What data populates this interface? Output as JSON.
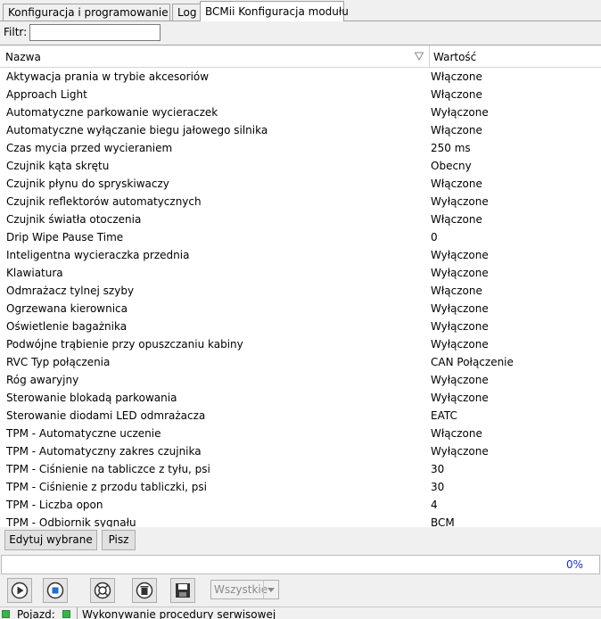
{
  "tabs": [
    {
      "label": "Konfiguracja i programowanie"
    },
    {
      "label": "Log"
    },
    {
      "label": "BCMii Konfiguracja modułu"
    }
  ],
  "filter": {
    "label": "Filtr:",
    "value": ""
  },
  "table": {
    "columns": {
      "name": "Nazwa",
      "value": "Wartość"
    },
    "rows": [
      {
        "name": "Aktywacja prania w trybie akcesoriów",
        "value": "Włączone"
      },
      {
        "name": "Approach Light",
        "value": "Włączone"
      },
      {
        "name": "Automatyczne parkowanie wycieraczek",
        "value": "Wyłączone"
      },
      {
        "name": "Automatyczne wyłączanie biegu jałowego silnika",
        "value": "Włączone"
      },
      {
        "name": "Czas mycia przed wycieraniem",
        "value": "250 ms"
      },
      {
        "name": "Czujnik kąta skrętu",
        "value": "Obecny"
      },
      {
        "name": "Czujnik płynu do spryskiwaczy",
        "value": "Włączone"
      },
      {
        "name": "Czujnik reflektorów automatycznych",
        "value": "Wyłączone"
      },
      {
        "name": "Czujnik światła otoczenia",
        "value": "Włączone"
      },
      {
        "name": "Drip Wipe Pause Time",
        "value": "0"
      },
      {
        "name": "Inteligentna wycieraczka przednia",
        "value": "Wyłączone"
      },
      {
        "name": "Klawiatura",
        "value": "Wyłączone"
      },
      {
        "name": "Odmrażacz tylnej szyby",
        "value": "Włączone"
      },
      {
        "name": "Ogrzewana kierownica",
        "value": "Wyłączone"
      },
      {
        "name": "Oświetlenie bagażnika",
        "value": "Wyłączone"
      },
      {
        "name": "Podwójne trąbienie przy opuszczaniu kabiny",
        "value": "Wyłączone"
      },
      {
        "name": "RVC Typ połączenia",
        "value": "CAN Połączenie"
      },
      {
        "name": "Róg awaryjny",
        "value": "Wyłączone"
      },
      {
        "name": "Sterowanie blokadą parkowania",
        "value": "Wyłączone"
      },
      {
        "name": "Sterowanie diodami LED odmrażacza",
        "value": "EATC"
      },
      {
        "name": "TPM - Automatyczne uczenie",
        "value": "Włączone"
      },
      {
        "name": "TPM - Automatyczny zakres czujnika",
        "value": "Wyłączone"
      },
      {
        "name": "TPM - Ciśnienie na tabliczce z tyłu, psi",
        "value": "30"
      },
      {
        "name": "TPM - Ciśnienie z przodu tabliczki, psi",
        "value": "30"
      },
      {
        "name": "TPM - Liczba opon",
        "value": "4"
      },
      {
        "name": "TPM - Odbiornik sygnału",
        "value": "BCM"
      }
    ]
  },
  "buttons": {
    "edit_label": "Edytuj wybrane",
    "write_label": "Pisz"
  },
  "progress": {
    "percent": 0,
    "text": "0%"
  },
  "toolbar": {
    "icons": [
      "play-icon",
      "stop-icon",
      "help-icon",
      "delete-icon",
      "save-icon"
    ],
    "select_value": "Wszystkie"
  },
  "status": {
    "vehicle_label": "Pojazd:",
    "message": "Wykonywanie procedury serwisowej"
  },
  "colors": {
    "status_green": "#3ab44a",
    "progress_text": "#1a2fd0"
  }
}
